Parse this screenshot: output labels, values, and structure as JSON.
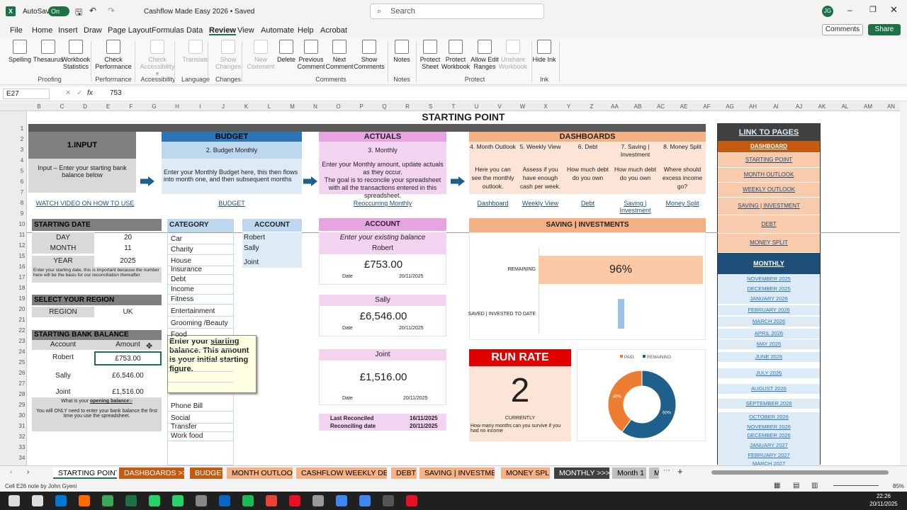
{
  "titlebar": {
    "autosave": "AutoSave",
    "toggle": "On",
    "doc_title": "Cashflow Made Easy 2026 • Saved",
    "search_placeholder": "Search",
    "user_initials": "JG"
  },
  "menu": [
    "File",
    "Home",
    "Insert",
    "Draw",
    "Page Layout",
    "Formulas",
    "Data",
    "Review",
    "View",
    "Automate",
    "Help",
    "Acrobat"
  ],
  "actions": {
    "comments": "Comments",
    "share": "Share"
  },
  "ribbon": {
    "buttons": [
      "Spelling",
      "Thesaurus",
      "Workbook Statistics",
      "Check Performance",
      "Check Accessibility ▾",
      "Translate",
      "Show Changes",
      "New Comment",
      "Delete",
      "Previous Comment",
      "Next Comment",
      "Show Comments",
      "Notes",
      "Protect Sheet",
      "Protect Workbook",
      "Allow Edit Ranges",
      "Unshare Workbook",
      "Hide Ink"
    ],
    "groups": [
      "Proofing",
      "Performance",
      "Accessibility",
      "Language",
      "Changes",
      "Comments",
      "Notes",
      "Protect",
      "Ink"
    ]
  },
  "formula": {
    "namebox": "E27",
    "fx": "fx",
    "value": "753"
  },
  "columns": [
    "B",
    "C",
    "D",
    "E",
    "F",
    "G",
    "H",
    "I",
    "J",
    "K",
    "L",
    "M",
    "N",
    "O",
    "P",
    "Q",
    "R",
    "S",
    "T",
    "U",
    "V",
    "W",
    "X",
    "Y",
    "Z",
    "AA",
    "AB",
    "AC",
    "AE",
    "AF",
    "AG",
    "AH",
    "AI",
    "AJ",
    "AK",
    "AL",
    "AM",
    "AN"
  ],
  "rows": [
    "1",
    "2",
    "3",
    "4",
    "5",
    "6",
    "7",
    "8",
    "9",
    "10",
    "11",
    "12",
    "15",
    "16",
    "17",
    "18",
    "19",
    "20",
    "21",
    "22",
    "23",
    "24",
    "25",
    "26",
    "27",
    "28",
    "29",
    "30",
    "31",
    "32",
    "33",
    "34",
    "35"
  ],
  "sheet": {
    "title": "STARTING POINT",
    "input": {
      "heading": "1.INPUT",
      "text": "Input – Enter your starting bank balance below",
      "link": "WATCH VIDEO ON HOW TO USE"
    },
    "budget": {
      "heading": "BUDGET",
      "sub": "2. Budget Monthly",
      "text": "Enter your Monthly Budget here, this then flows into month one, and then subsequent months",
      "link": "BUDGET"
    },
    "actuals": {
      "heading": "ACTUALS",
      "sub": "3. Monthly",
      "text1": "Enter your Monthly amount, update actuals as they occur.",
      "text2": "The goal is to reconcile your spreadsheet with all the transactions entered in this spreadsheet.",
      "link": "Reoccurring Monthly"
    },
    "dashboards": {
      "heading": "DASHBOARDS",
      "cols": [
        {
          "sub": "4. Month Outlook",
          "text": "Here you can see the monthly outlook.",
          "link": "Dashboard"
        },
        {
          "sub": "5. Weekly View",
          "text": "Assess if you have enough cash per week.",
          "link": "Weekly View"
        },
        {
          "sub": "6. Debt",
          "text": "How much debt do you own",
          "link": "Debt"
        },
        {
          "sub": "7. Saving | Investment",
          "text": "How much debt do you own",
          "link": "Saving | Investment"
        },
        {
          "sub": "8. Money Split",
          "text": "Where should excess income go?",
          "link": "Money Split"
        }
      ]
    },
    "links": {
      "heading": "LINK TO PAGES",
      "items": [
        "DASHBOARD",
        "STARTING POINT",
        "MONTH OUTLOOK",
        "WEEKLY OUTLOOK",
        "SAVING | INVESTMENT",
        "DEBT",
        "MONEY SPLIT"
      ],
      "monthly": "MONTHLY",
      "months": [
        "NOVEMBER 2025",
        "DECEMBER 2025",
        "JANUARY 2026",
        "FEBRUARY 2026",
        "MARCH 2026",
        "APRIL 2026",
        "MAY 2026",
        "JUNE 2026",
        "JULY 2026",
        "AUGUST 2026",
        "SEPTEMBER 2026",
        "OCTOBER 2026",
        "NOVEMBER 2026",
        "DECEMBER 2026",
        "JANUARY 2027",
        "FEBRUARY 2027",
        "MARCH 2027"
      ]
    },
    "starting_date": {
      "heading": "STARTING DATE",
      "day_label": "DAY",
      "day": "20",
      "month_label": "MONTH",
      "month": "11",
      "year_label": "YEAR",
      "year": "2025",
      "note": "Enter your starting date, this is important because the number here will be the basis for our reconciliation thereafter"
    },
    "region": {
      "heading": "SELECT YOUR REGION",
      "label": "REGION",
      "value": "UK"
    },
    "bank": {
      "heading": "STARTING BANK BALANCE",
      "col1": "Account",
      "col2": "Amount",
      "rows": [
        {
          "name": "Robert",
          "amount": "£753.00"
        },
        {
          "name": "Sally",
          "amount": "£6,546.00"
        },
        {
          "name": "Joint",
          "amount": "£1,516.00"
        }
      ],
      "opening": "What is your",
      "opening_u": "opening balance:-",
      "note": "You will ONLY need to enter your bank balance the first time you use the spreadsheet."
    },
    "note_popup": {
      "pre": "Enter your ",
      "u": "starting",
      "post": " balance. This amount is your initial starting figure."
    },
    "category": {
      "heading": "CATEGORY",
      "items": [
        "Car",
        "Charity",
        "House",
        "Insurance",
        "Debt",
        "Income",
        "Fitness",
        "Entertainment",
        "Grooming /Beauty",
        "Food",
        "",
        "",
        "",
        "",
        "Phone Bill",
        "Social",
        "Transfer",
        "Work food"
      ]
    },
    "account_list": {
      "heading": "ACCOUNT",
      "items": [
        "Robert",
        "Sally",
        "Joint"
      ]
    },
    "account_panel": {
      "heading": "ACCOUNT",
      "hint": "Enter your existing balance",
      "cards": [
        {
          "name": "Robert",
          "amount": "£753.00",
          "date_label": "Date",
          "date": "20/11/2025"
        },
        {
          "name": "Sally",
          "amount": "£6,546.00",
          "date_label": "Date",
          "date": "20/11/2025"
        },
        {
          "name": "Joint",
          "amount": "£1,516.00",
          "date_label": "Date",
          "date": "20/11/2025"
        }
      ],
      "last_rec_label": "Last Reconciled",
      "last_rec": "16/11/2025",
      "rec_date_label": "Reconciling date",
      "rec_date": "20/11/2025"
    },
    "saving": {
      "heading": "SAVING | INVESTMENTS",
      "remaining_label": "REMAINING",
      "remaining": "96%",
      "saved_label": "SAVED | INVESTED TO DATE",
      "saved_fraction": 0.04
    },
    "runrate": {
      "heading": "RUN RATE",
      "value": "2",
      "currently": "CURRENTLY",
      "note": "How many months can you survive if you had no income"
    },
    "donut": {
      "legend": [
        "PAID",
        "REMAINING"
      ],
      "values": [
        40,
        60
      ],
      "labels": [
        "40%",
        "60%"
      ],
      "colors": [
        "#ed7d31",
        "#1f5f8b"
      ]
    }
  },
  "tabs": [
    {
      "label": "STARTING POINT",
      "color": "#ffffff",
      "active": true,
      "text": "#000"
    },
    {
      "label": "DASHBOARDS >>>",
      "color": "#c55a11",
      "text": "#fff"
    },
    {
      "label": "BUDGET",
      "color": "#c55a11",
      "text": "#fff"
    },
    {
      "label": "MONTH OUTLOOK",
      "color": "#f4b183",
      "text": "#000"
    },
    {
      "label": "CASHFLOW WEEKLY DETAIL",
      "color": "#f4b183",
      "text": "#000"
    },
    {
      "label": "DEBT",
      "color": "#f4b183",
      "text": "#000"
    },
    {
      "label": "SAVING | INVESTMENT",
      "color": "#f4b183",
      "text": "#000"
    },
    {
      "label": "MONEY SPLIT",
      "color": "#f4b183",
      "text": "#000"
    },
    {
      "label": "MONTHLY >>>",
      "color": "#404040",
      "text": "#fff"
    },
    {
      "label": "Month 1",
      "color": "#bfbfbf",
      "text": "#000"
    },
    {
      "label": "M",
      "color": "#bfbfbf",
      "text": "#000"
    }
  ],
  "status": {
    "left": "Cell E26 note by John Gyeni",
    "zoom": "85%"
  },
  "clock": {
    "time": "22:26",
    "date": "20/11/2025"
  }
}
